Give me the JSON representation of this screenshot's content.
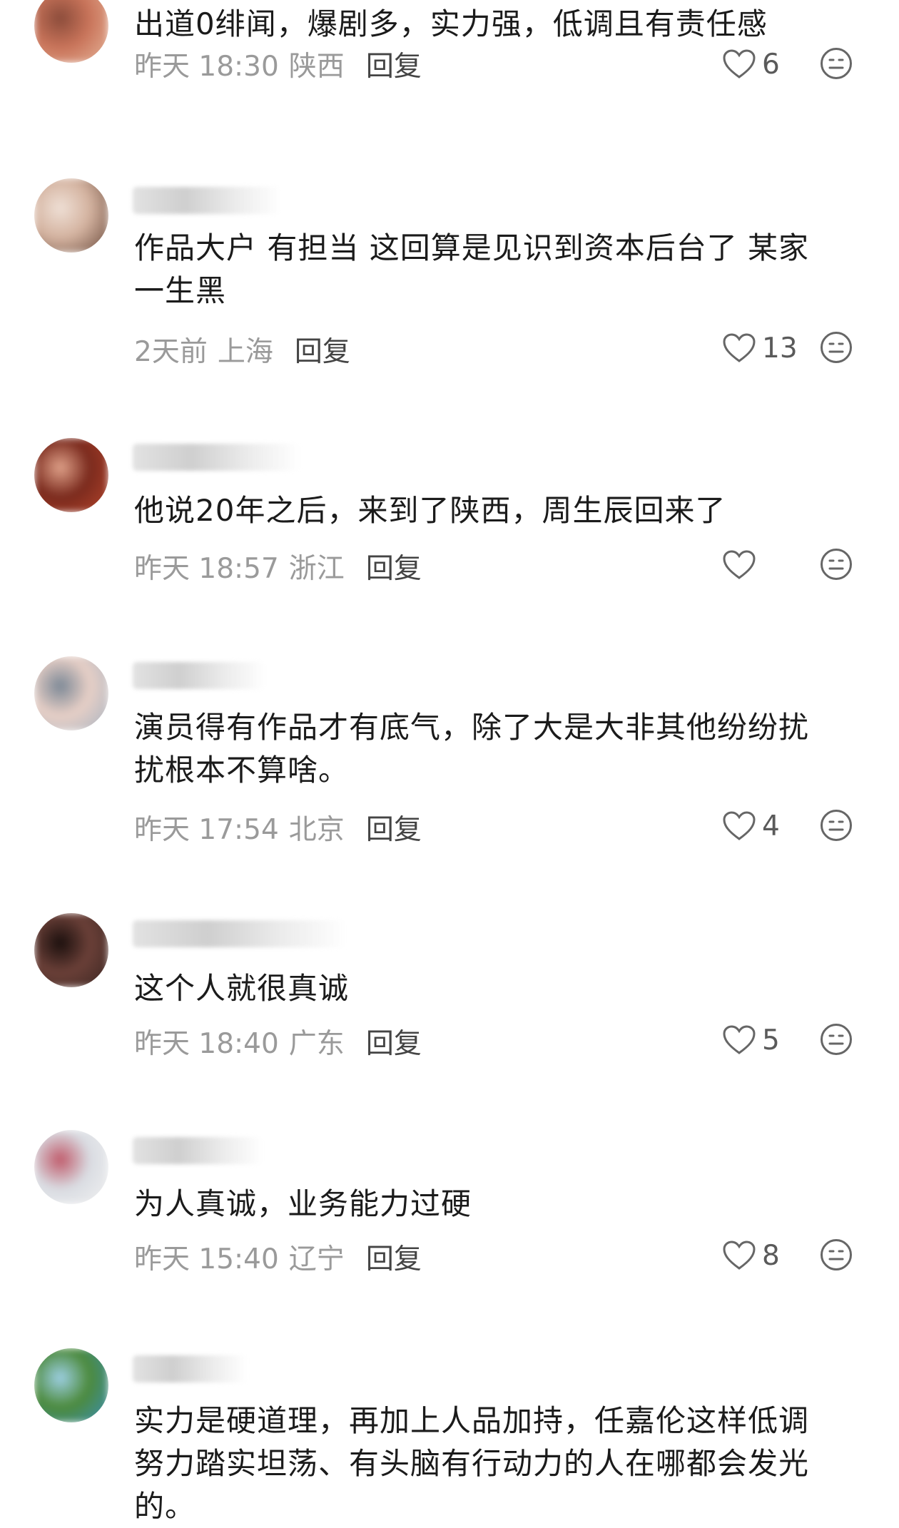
{
  "comments": [
    {
      "name": "",
      "lines": [
        "出道0绯闻，爆剧多，实力强，低调且有责任感"
      ],
      "time": "昨天 18:30",
      "location": "陕西",
      "reply": "回复",
      "likes": "6",
      "avatar_colors": [
        "#e6b59a",
        "#c9745a",
        "#8a4b3a"
      ]
    },
    {
      "name": "郑郑",
      "lines": [
        "作品大户 有担当 这回算是见识到资本后台了 某家",
        "一生黑"
      ],
      "time": "2天前",
      "location": "上海",
      "reply": "回复",
      "likes": "13",
      "avatar_colors": [
        "#6a4a3c",
        "#d4b3a0",
        "#efe0d6"
      ]
    },
    {
      "name": "",
      "lines": [
        "他说20年之后，来到了陕西，周生辰回来了"
      ],
      "time": "昨天 18:57",
      "location": "浙江",
      "reply": "回复",
      "likes": "",
      "avatar_colors": [
        "#b4442c",
        "#7a2a1d",
        "#e0a28a"
      ]
    },
    {
      "name": "",
      "lines": [
        "演员得有作品才有底气，除了大是大非其他纷纷扰",
        "扰根本不算啥。"
      ],
      "time": "昨天 17:54",
      "location": "北京",
      "reply": "回复",
      "likes": "4",
      "avatar_colors": [
        "#a8b4c2",
        "#e7cfc6",
        "#7b8896"
      ]
    },
    {
      "name": "我想看见沈渡",
      "lines": [
        "这个人就很真诚"
      ],
      "time": "昨天 18:40",
      "location": "广东",
      "reply": "回复",
      "likes": "5",
      "avatar_colors": [
        "#3b2622",
        "#6b4038",
        "#1a0f0d"
      ]
    },
    {
      "name": "张洪雨",
      "lines": [
        "为人真诚，业务能力过硬"
      ],
      "time": "昨天 15:40",
      "location": "辽宁",
      "reply": "回复",
      "likes": "8",
      "avatar_colors": [
        "#f2f2f2",
        "#d9dce2",
        "#c05a6a"
      ]
    },
    {
      "name": "",
      "lines": [
        "实力是硬道理，再加上人品加持，任嘉伦这样低调",
        "努力踏实坦荡、有头脑有行动力的人在哪都会发光",
        "的。"
      ],
      "time": "",
      "location": "",
      "reply": "",
      "likes": "",
      "avatar_colors": [
        "#3a8fb8",
        "#4c8a3c",
        "#9ed0e6"
      ]
    }
  ],
  "icons": {
    "like": "heart-outline-icon",
    "emoji": "smiley-face-icon"
  }
}
